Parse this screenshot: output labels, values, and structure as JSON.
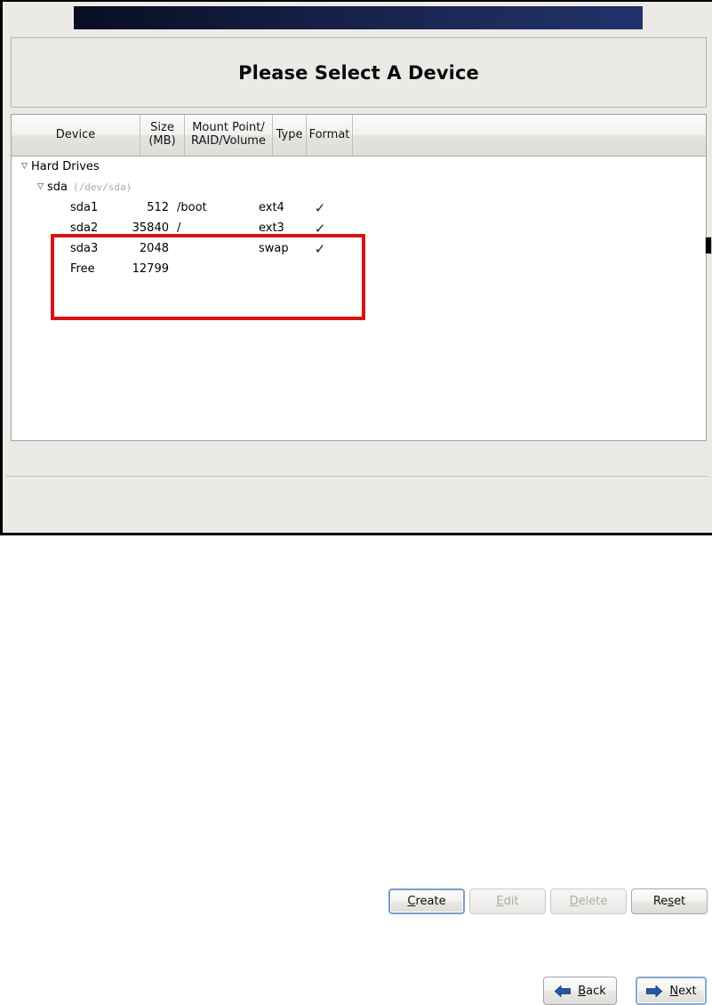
{
  "window": {
    "title": "Please Select A Device"
  },
  "banner": {
    "name": "product-banner"
  },
  "table": {
    "columns": [
      {
        "label": "Device",
        "key": "device"
      },
      {
        "label": "Size\n(MB)",
        "label_line1": "Size",
        "label_line2": "(MB)",
        "key": "size"
      },
      {
        "label": "Mount Point/\nRAID/Volume",
        "label_line1": "Mount Point/",
        "label_line2": "RAID/Volume",
        "key": "mount"
      },
      {
        "label": "Type",
        "key": "type"
      },
      {
        "label": "Format",
        "key": "format"
      }
    ],
    "tree": {
      "root_label": "Hard Drives",
      "root_expanded": true,
      "root_triangle": "▽",
      "drive_label": "sda",
      "drive_path": "(/dev/sda)",
      "drive_expanded": true,
      "drive_triangle": "▽"
    },
    "rows": [
      {
        "device": "sda1",
        "size": "512",
        "mount": "/boot",
        "type": "ext4",
        "format": "✓"
      },
      {
        "device": "sda2",
        "size": "35840",
        "mount": "/",
        "type": "ext3",
        "format": "✓"
      },
      {
        "device": "sda3",
        "size": "2048",
        "mount": "",
        "type": "swap",
        "format": "✓"
      },
      {
        "device": "Free",
        "size": "12799",
        "mount": "",
        "type": "",
        "format": ""
      }
    ]
  },
  "annotation": {
    "highlight_color": "#d81515"
  },
  "actions": {
    "create": {
      "label": "Create",
      "mnemonic": "C",
      "rest": "reate",
      "enabled": true,
      "focused": true
    },
    "edit": {
      "label": "Edit",
      "mnemonic": "E",
      "rest": "dit",
      "enabled": false,
      "focused": false
    },
    "delete": {
      "label": "Delete",
      "mnemonic": "D",
      "rest": "elete",
      "enabled": false,
      "focused": false
    },
    "reset": {
      "label": "Reset",
      "pre": "Re",
      "mnemonic": "s",
      "rest": "et",
      "enabled": true,
      "focused": false
    }
  },
  "navigation": {
    "back": {
      "label": "Back",
      "mnemonic": "B",
      "rest": "ack",
      "icon": "arrow-left-icon",
      "color": "#1f4e9c"
    },
    "next": {
      "label": "Next",
      "mnemonic": "N",
      "rest": "ext",
      "icon": "arrow-right-icon",
      "color": "#1f4e9c",
      "focused": true
    }
  }
}
